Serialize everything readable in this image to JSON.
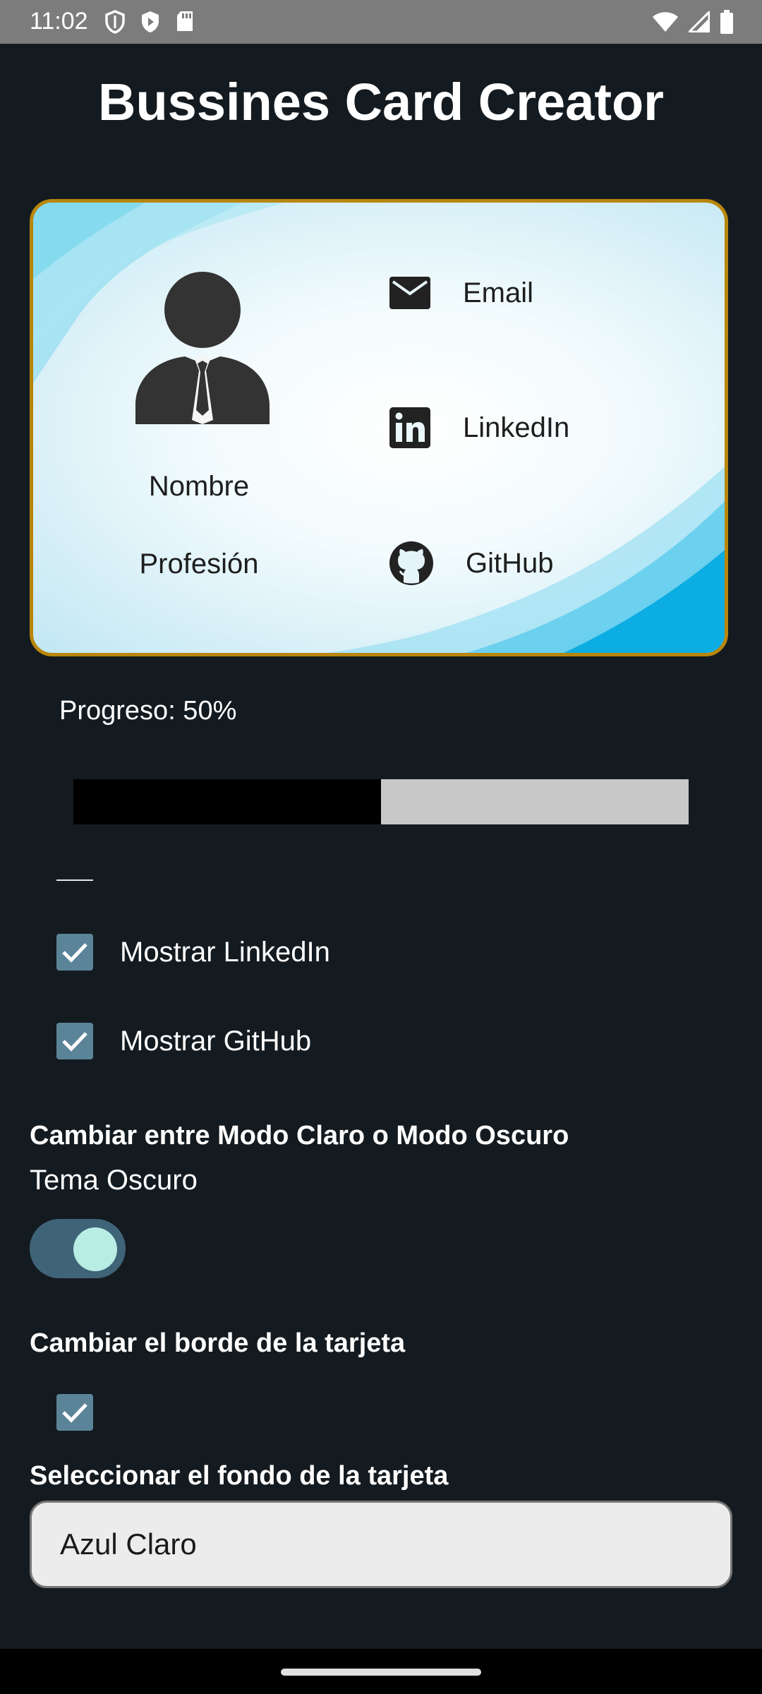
{
  "status_bar": {
    "time": "11:02",
    "left_icons": [
      "shield-outline-icon",
      "play-shield-icon",
      "sd-card-icon"
    ],
    "right_icons": [
      "wifi-icon",
      "signal-icon",
      "battery-icon"
    ]
  },
  "app_title": "Bussines Card Creator",
  "card": {
    "border_color": "#b8860b",
    "name": "Nombre",
    "profession": "Profesión",
    "email_label": "Email",
    "linkedin_label": "LinkedIn",
    "github_label": "GitHub",
    "icons": [
      "person-avatar-icon",
      "email-icon",
      "linkedin-icon",
      "github-icon"
    ]
  },
  "progress": {
    "label": "Progreso: 50%",
    "value": 0.5,
    "fill_color": "#000000",
    "track_color": "#c8c8c8"
  },
  "options": {
    "show_linkedin_label": "Mostrar LinkedIn",
    "show_linkedin_checked": true,
    "show_github_label": "Mostrar GitHub",
    "show_github_checked": true
  },
  "theme": {
    "section_title": "Cambiar entre Modo Claro o Modo Oscuro",
    "label": "Tema Oscuro",
    "dark_enabled": true
  },
  "border": {
    "section_title": "Cambiar el borde de la tarjeta",
    "checked": true
  },
  "background": {
    "section_title": "Seleccionar el fondo de la tarjeta",
    "selected": "Azul Claro"
  },
  "colors": {
    "app_background": "#141b20",
    "checkbox": "#5b8499",
    "toggle_track": "#3f6478",
    "toggle_knob": "#b8ede4"
  }
}
